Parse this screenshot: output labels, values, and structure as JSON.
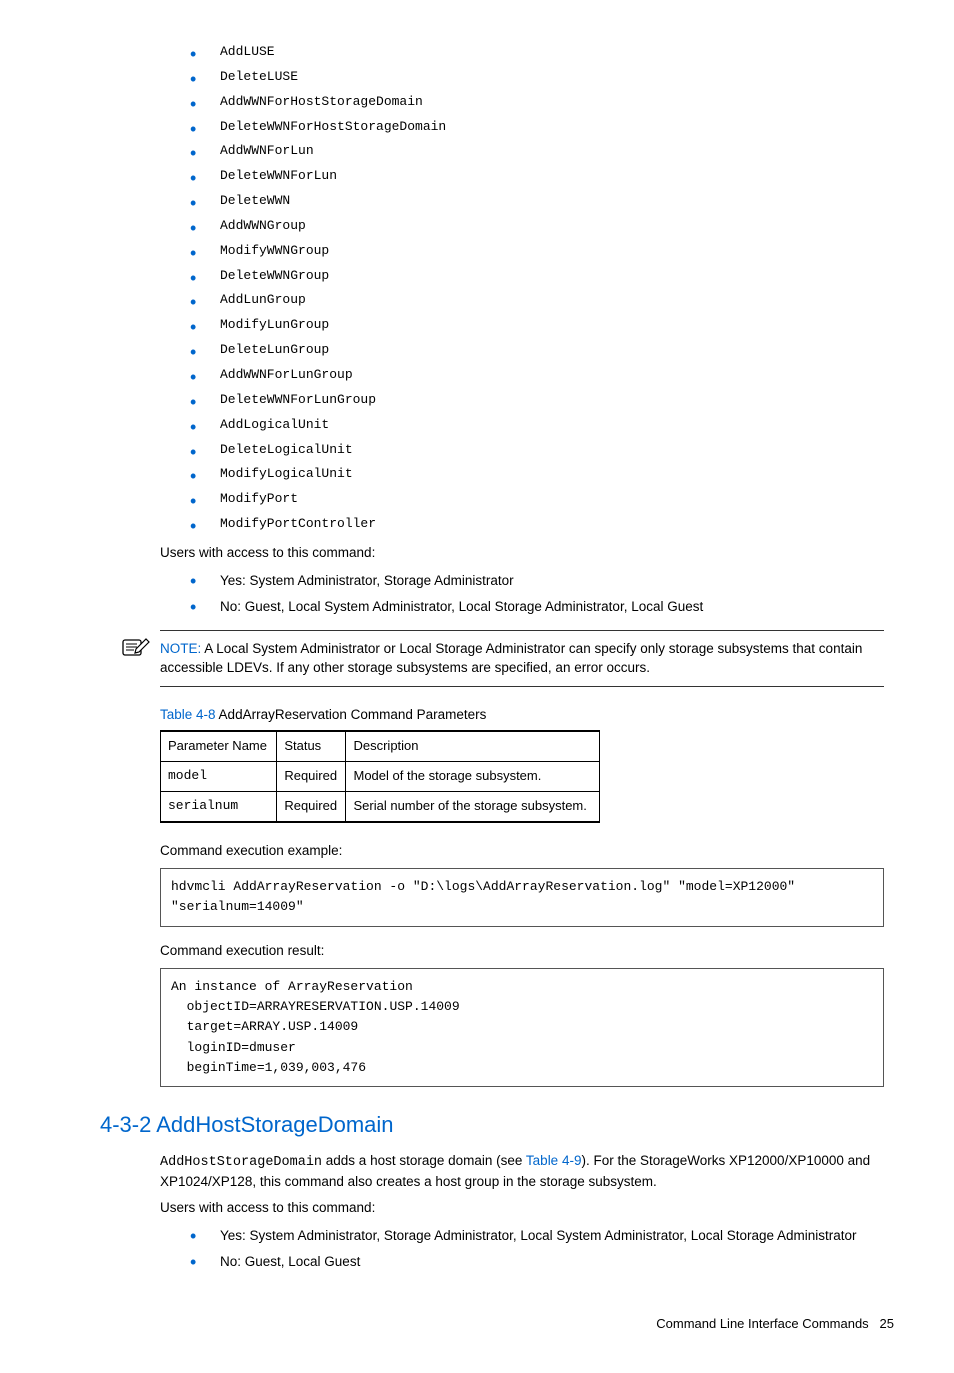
{
  "commands": [
    "AddLUSE",
    "DeleteLUSE",
    "AddWWNForHostStorageDomain",
    "DeleteWWNForHostStorageDomain",
    "AddWWNForLun",
    "DeleteWWNForLun",
    "DeleteWWN",
    "AddWWNGroup",
    "ModifyWWNGroup",
    "DeleteWWNGroup",
    "AddLunGroup",
    "ModifyLunGroup",
    "DeleteLunGroup",
    "AddWWNForLunGroup",
    "DeleteWWNForLunGroup",
    "AddLogicalUnit",
    "DeleteLogicalUnit",
    "ModifyLogicalUnit",
    "ModifyPort",
    "ModifyPortController"
  ],
  "access_intro": "Users with access to this command:",
  "access_list": [
    "Yes: System Administrator, Storage Administrator",
    "No: Guest, Local System Administrator, Local Storage Administrator, Local Guest"
  ],
  "note": {
    "label": "NOTE:",
    "text": "  A Local System Administrator or Local Storage Administrator can specify only storage subsystems that contain accessible LDEVs. If any other storage subsystems are specified, an error occurs."
  },
  "table": {
    "caption_link": "Table 4-8",
    "caption_rest": "  AddArrayReservation Command Parameters",
    "headers": [
      "Parameter Name",
      "Status",
      "Description"
    ],
    "rows": [
      {
        "name": "model",
        "status": "Required",
        "desc": "Model of the storage subsystem."
      },
      {
        "name": "serialnum",
        "status": "Required",
        "desc": "Serial number of the storage subsystem."
      }
    ]
  },
  "exec_example_label": "Command execution example:",
  "exec_example_code": "hdvmcli AddArrayReservation -o \"D:\\logs\\AddArrayReservation.log\" \"model=XP12000\" \"serialnum=14009\"",
  "exec_result_label": "Command execution result:",
  "exec_result_code": "An instance of ArrayReservation\n  objectID=ARRAYRESERVATION.USP.14009\n  target=ARRAY.USP.14009\n  loginID=dmuser\n  beginTime=1,039,003,476",
  "section": {
    "heading": "4-3-2 AddHostStorageDomain",
    "cmd": "AddHostStorageDomain",
    "para_before": " adds a host storage domain (see ",
    "link": "Table 4-9",
    "para_after": "). For the StorageWorks XP12000/XP10000 and XP1024/XP128, this command also creates a host group in the storage subsystem.",
    "access_intro": "Users with access to this command:",
    "access_list": [
      "Yes: System Administrator, Storage Administrator, Local System Administrator, Local Storage Administrator",
      "No: Guest, Local Guest"
    ]
  },
  "footer": {
    "text": "Command Line Interface Commands",
    "page": "25"
  }
}
